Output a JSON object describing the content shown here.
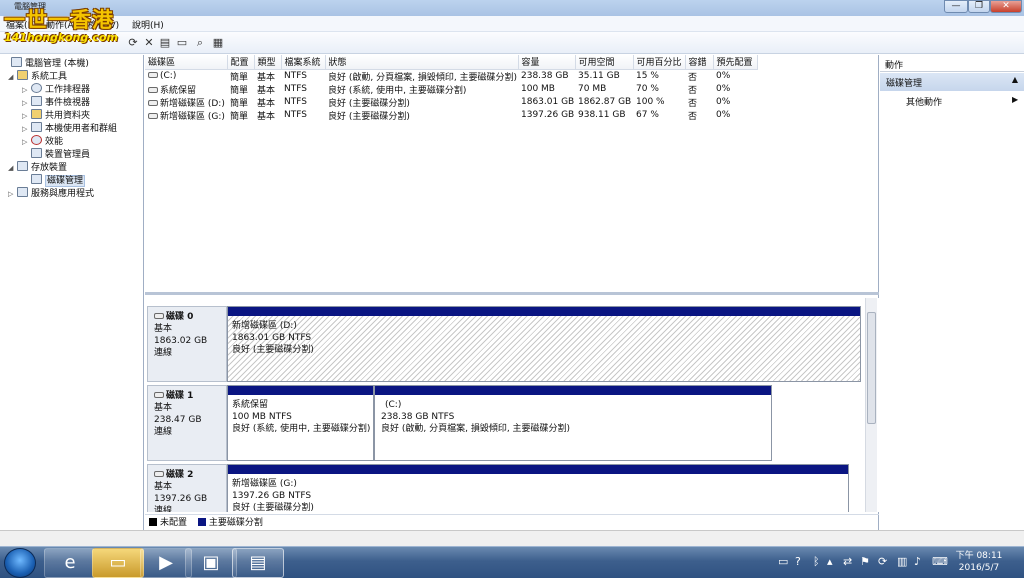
{
  "window": {
    "title": "電腦管理",
    "min_label": "—",
    "max_label": "❐",
    "close_label": "✕"
  },
  "watermark": {
    "line1": "一世一香港",
    "line2": "141hongkong.com"
  },
  "menubar": {
    "items": [
      "檔案(F)",
      "動作(A)",
      "檢視(V)",
      "說明(H)"
    ]
  },
  "toolbar": {
    "icons": [
      "back-icon",
      "forward-icon",
      "up-icon",
      "refresh-icon",
      "delete-icon",
      "properties-icon",
      "open-icon",
      "search-icon",
      "export-icon"
    ]
  },
  "tree": {
    "root": "電腦管理 (本機)",
    "system_tools": "系統工具",
    "items": [
      "工作排程器",
      "事件檢視器",
      "共用資料夾",
      "本機使用者和群組",
      "效能",
      "裝置管理員"
    ],
    "storage": "存放裝置",
    "disk_mgmt": "磁碟管理",
    "services": "服務與應用程式"
  },
  "volumes": {
    "columns": [
      "磁碟區",
      "配置",
      "類型",
      "檔案系統",
      "狀態",
      "容量",
      "可用空間",
      "可用百分比",
      "容錯",
      "預先配置"
    ],
    "rows": [
      [
        "(C:)",
        "簡單",
        "基本",
        "NTFS",
        "良好 (啟動, 分頁檔案, 損毀傾印, 主要磁碟分割)",
        "238.38 GB",
        "35.11 GB",
        "15 %",
        "否",
        "0%"
      ],
      [
        "系統保留",
        "簡單",
        "基本",
        "NTFS",
        "良好 (系統, 使用中, 主要磁碟分割)",
        "100 MB",
        "70 MB",
        "70 %",
        "否",
        "0%"
      ],
      [
        "新增磁碟區 (D:)",
        "簡單",
        "基本",
        "NTFS",
        "良好 (主要磁碟分割)",
        "1863.01 GB",
        "1862.87 GB",
        "100 %",
        "否",
        "0%"
      ],
      [
        "新增磁碟區 (G:)",
        "簡單",
        "基本",
        "NTFS",
        "良好 (主要磁碟分割)",
        "1397.26 GB",
        "938.11 GB",
        "67 %",
        "否",
        "0%"
      ]
    ]
  },
  "disks": [
    {
      "name": "磁碟 0",
      "type": "基本",
      "size": "1863.02 GB",
      "status": "連線",
      "parts": [
        {
          "name": "新增磁碟區 (D:)",
          "size": "1863.01 GB NTFS",
          "status": "良好 (主要磁碟分割)"
        }
      ]
    },
    {
      "name": "磁碟 1",
      "type": "基本",
      "size": "238.47 GB",
      "status": "連線",
      "parts": [
        {
          "name": "系統保留",
          "size": "100 MB NTFS",
          "status": "良好 (系統, 使用中, 主要磁碟分割)"
        },
        {
          "name": "(C:)",
          "size": "238.38 GB NTFS",
          "status": "良好 (啟動, 分頁檔案, 損毀傾印, 主要磁碟分割)"
        }
      ]
    },
    {
      "name": "磁碟 2",
      "type": "基本",
      "size": "1397.26 GB",
      "status": "連線",
      "parts": [
        {
          "name": "新增磁碟區 (G:)",
          "size": "1397.26 GB NTFS",
          "status": "良好 (主要磁碟分割)"
        }
      ]
    }
  ],
  "legend": {
    "unallocated": "未配置",
    "primary": "主要磁碟分割",
    "unallocated_color": "#000000",
    "primary_color": "#0a1582"
  },
  "actions": {
    "title": "動作",
    "section": "磁碟管理",
    "more": "其他動作"
  },
  "taskbar": {
    "apps": [
      "ie-icon",
      "explorer-icon",
      "media-player-icon",
      "control-panel-icon",
      "computer-management-icon"
    ]
  },
  "clock": {
    "time": "下午 08:11",
    "date": "2016/5/7"
  }
}
